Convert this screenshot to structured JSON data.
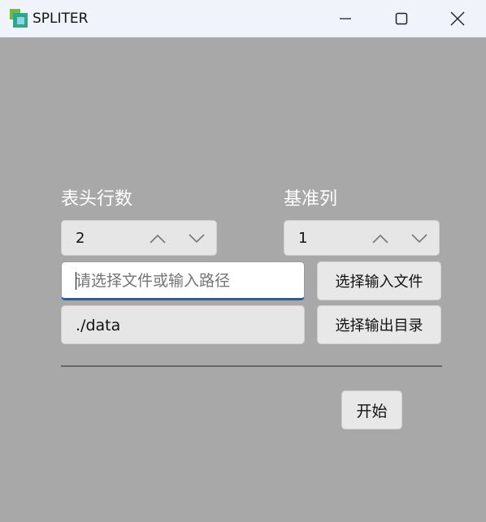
{
  "window": {
    "title": "SPLITER",
    "icons": {
      "app": "app-icon",
      "minimize": "minimize-icon",
      "maximize": "maximize-icon",
      "close": "close-icon"
    }
  },
  "form": {
    "header_rows": {
      "label": "表头行数",
      "value": "2"
    },
    "base_column": {
      "label": "基准列",
      "value": "1"
    },
    "input_path": {
      "placeholder": "请选择文件或输入路径",
      "value": ""
    },
    "output_dir": {
      "value": "./data"
    },
    "select_input_button": "选择输入文件",
    "select_output_button": "选择输出目录",
    "start_button": "开始"
  },
  "colors": {
    "background": "#a8a8a8",
    "titlebar": "#f0f3f9",
    "focus_accent": "#1a62b0"
  }
}
